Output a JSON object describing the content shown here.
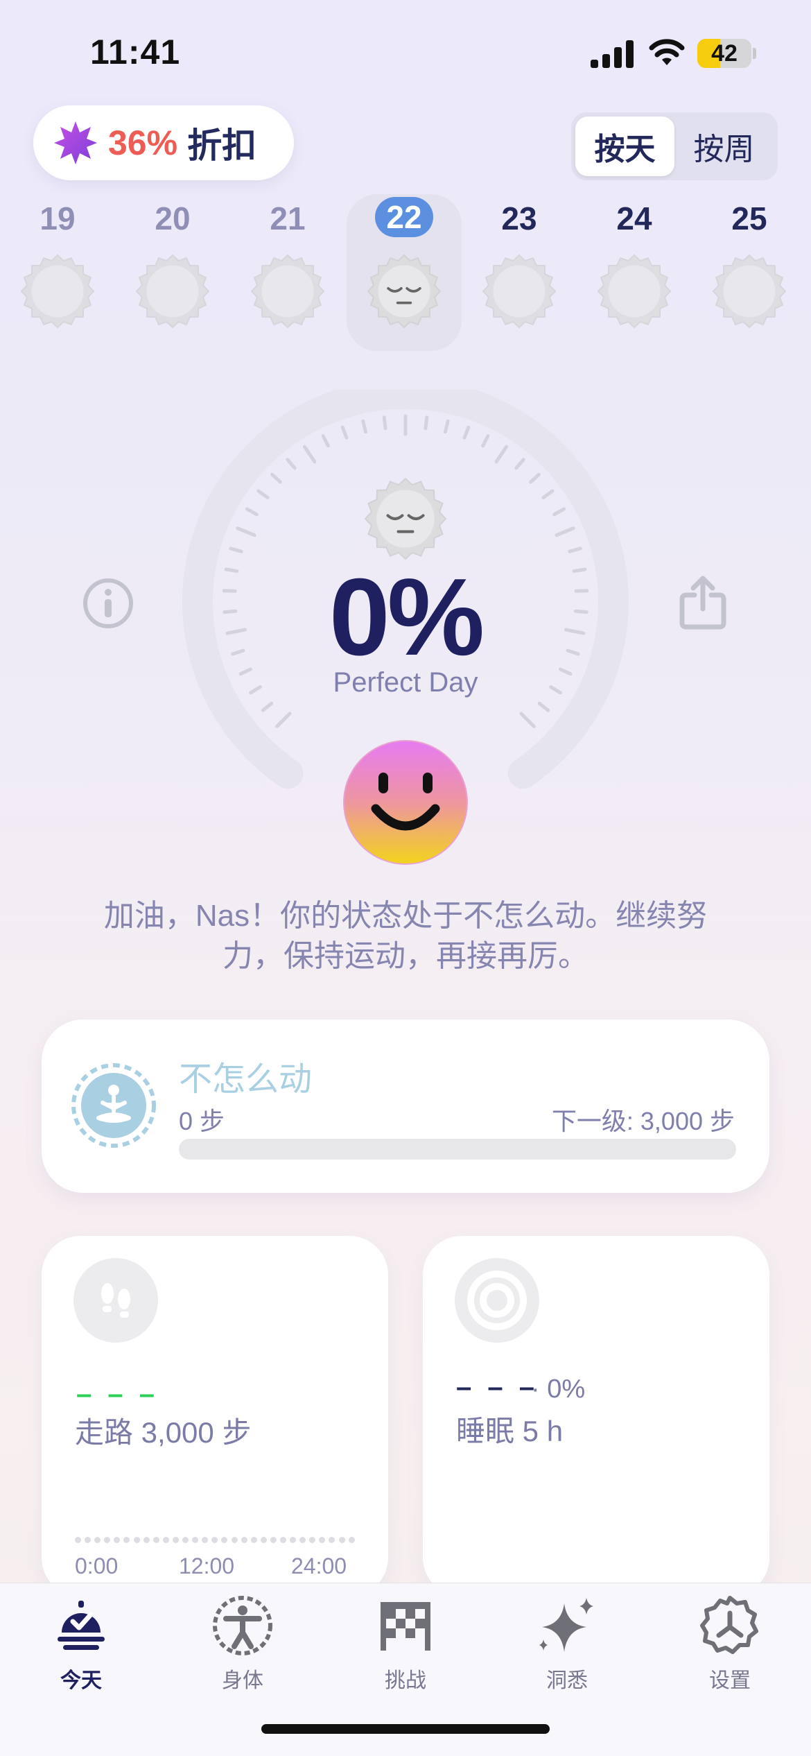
{
  "status_bar": {
    "time": "11:41",
    "battery": "42",
    "battery_level": 0.42
  },
  "promo": {
    "percent": "36%",
    "label": "折扣"
  },
  "view_toggle": {
    "options": [
      "按天",
      "按周"
    ],
    "selected": "按天"
  },
  "days": [
    {
      "num": "19",
      "state": "past"
    },
    {
      "num": "20",
      "state": "past"
    },
    {
      "num": "21",
      "state": "past"
    },
    {
      "num": "22",
      "state": "selected"
    },
    {
      "num": "23",
      "state": "future"
    },
    {
      "num": "24",
      "state": "future"
    },
    {
      "num": "25",
      "state": "future"
    }
  ],
  "summary": {
    "percent": "0%",
    "percent_value": 0,
    "subtitle": "Perfect Day",
    "message": "加油，Nas！你的状态处于不怎么动。继续努力，保持运动，再接再厉。"
  },
  "level_card": {
    "title": "不怎么动",
    "steps": "0 步",
    "next": "下一级: 3,000 步",
    "progress": 0
  },
  "walk_card": {
    "value": "– – –",
    "label": "走路 3,000 步",
    "ticks": [
      "0:00",
      "12:00",
      "24:00"
    ]
  },
  "sleep_card": {
    "value": "– – –",
    "percent": "· 0%",
    "label": "睡眠 5 h"
  },
  "tabs": [
    {
      "label": "今天",
      "icon": "today-icon",
      "active": true
    },
    {
      "label": "身体",
      "icon": "body-icon",
      "active": false
    },
    {
      "label": "挑战",
      "icon": "checkered-flag-icon",
      "active": false
    },
    {
      "label": "洞悉",
      "icon": "sparkle-icon",
      "active": false
    },
    {
      "label": "设置",
      "icon": "gear-icon",
      "active": false
    }
  ],
  "colors": {
    "accent": "#5b8fe0",
    "brand_dark": "#1e2060",
    "walk_green": "#2dcf5a",
    "promo_red": "#ee5d55",
    "level_blue": "#a9cfe3"
  }
}
